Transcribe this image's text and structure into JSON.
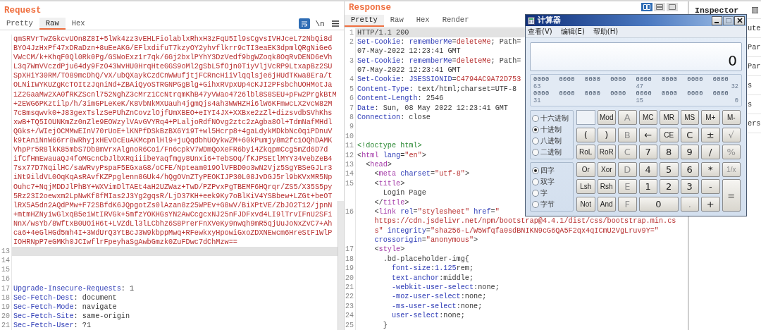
{
  "request": {
    "title": "Request",
    "tabs": [
      {
        "label": "Pretty",
        "selected": false
      },
      {
        "label": "Raw",
        "selected": true
      },
      {
        "label": "Hex",
        "selected": false
      }
    ],
    "tools": [
      {
        "kind": "wrap",
        "selected": true
      },
      {
        "kind": "newline",
        "label": "\\n",
        "selected": false
      },
      {
        "kind": "menu",
        "selected": false
      }
    ],
    "lines": [
      {
        "segments": [
          {
            "kind": "string",
            "text": "qmSRVrTwZGkcvUOn8Z8I+5lWk4zz3vEHLFiolablxRhxH3zFqU5Il9sCgvsIVHJceL72NbQi8d"
          }
        ],
        "highlighted": false
      },
      {
        "segments": [
          {
            "kind": "string",
            "text": "BYO4JzHxPf47xDRaDzn+8uEeAKG/EFlxdifuT7kzyOY2yhvflkrr9cTI3eaEK3dpmlQRgNiGe6"
          }
        ],
        "highlighted": false
      },
      {
        "segments": [
          {
            "kind": "string",
            "text": "VWcCM/k+KhqF0Ql0Rk0Pg/GSWoExz1r7qk/6Gj2bxlPYhY3DzVedf9bgWZoqk8OqRvDEND6eVh"
          }
        ],
        "highlighted": false
      },
      {
        "segments": [
          {
            "kind": "string",
            "text": "L3q7WmVVczdPju64dy9Fz043WvHU0HrqHteGGS9oMl2gSbL5fOjn0TiyVljVcRP9LtxapBz2SU"
          }
        ],
        "highlighted": false
      },
      {
        "segments": [
          {
            "kind": "string",
            "text": "SpXHiY30RM/TO89mcDhQ/vX/ubQXaykCzdCnWWufjtjFCRncHiiVlqqlsje6jHUdTKwa8Era/t"
          }
        ],
        "highlighted": false
      },
      {
        "segments": [
          {
            "kind": "string",
            "text": "OLNiIWYKUZgKcTOItzJqniNd+ZBAiQyoSTRGNPGgBlg+GihxRVpxUp4cKJI2PFsbchUOHMotJa"
          }
        ],
        "highlighted": false
      },
      {
        "segments": [
          {
            "kind": "string",
            "text": "1Z2GaaMw2XA0fRKZScnl752NghZ3cMrz1CcNtrqmKhB47yVWao4726lbl8S8SEU+pFw2PrgkBtM"
          }
        ],
        "highlighted": false
      },
      {
        "segments": [
          {
            "kind": "string",
            "text": "+2EWG6PKztilp/h/3imGPLeKeK/K8VbNkMXUauh4jgmQjs4ah3WWHZHi6lW6KFmwcLX2vcW82M"
          }
        ],
        "highlighted": false
      },
      {
        "segments": [
          {
            "kind": "string",
            "text": "7cBmsqwvk0+J83gexTslzSePUhZnCovzlOjfUmXBEO+eIYI4JX+XXBxe2zZl+dizsvdbSVhKhs"
          }
        ],
        "highlighted": false
      },
      {
        "segments": [
          {
            "kind": "string",
            "text": "xwB+TQ5IOUNKmZz0nZle9EOWzylVAvGVYRq4+PLaljoRdfNOvg2ztc2zAgba8Ol+TdmNafMHdl"
          }
        ],
        "highlighted": false
      },
      {
        "segments": [
          {
            "kind": "string",
            "text": "QGks+/WIejOCMMwEInV70rUoE+lKNPfDSkBzBX6Y19T+wl5Hcrp8+4gaLdykMDkbNc0qiPDnuV"
          }
        ],
        "highlighted": false
      },
      {
        "segments": [
          {
            "kind": "string",
            "text": "k9tAniNnW66rr8wRhyjxHEvOcEuAKMcpnlHl9+juQqdbhUOykwZM+60kPumjy8m2fc1OQhDAMK"
          }
        ],
        "highlighted": false
      },
      {
        "segments": [
          {
            "kind": "string",
            "text": "VhpPr5R8lkK85mbS7Db8mVrxAlgnoR6Coi/Fn6cpkV7WDmQoXeFR6byi4ZkqpmCcg5mZd6D7d"
          }
        ],
        "highlighted": false
      },
      {
        "segments": [
          {
            "kind": "string",
            "text": "ifCfHmEwauaQJ4foMGcnCbJlbXRqiiibeYaqfmgy8Unxi6+TebSOq/fKJPSEtlMYY34vebZeB4"
          }
        ],
        "highlighted": false
      },
      {
        "segments": [
          {
            "kind": "string",
            "text": "7sx77D7NqilHC/saWRvyPspaF5EGxaG8/oCFE/Npteam019OlVFBD0o3wN2Vjz5SgYBSeGJLr3"
          }
        ],
        "highlighted": false
      },
      {
        "segments": [
          {
            "kind": "string",
            "text": "iNt9ildVL0OqKqAsRAvfKZPpglenn8GUk4/hQgOVnZTyPEOKIJP30L08JvDGJ5rl9bKVxMR5Np"
          }
        ],
        "highlighted": false
      },
      {
        "segments": [
          {
            "kind": "string",
            "text": "Ouhc7+NqjMDDJlPhBY+WXVimDlTAEt4aH2UZWaz+TwD/PZPvxPgTBEMF6HQrqr/ZS5/X35S5py"
          }
        ],
        "highlighted": false
      },
      {
        "segments": [
          {
            "kind": "string",
            "text": "5Rz23I2oewxm2LpNwKf8fMIas2J3Yg2gqsR/LjD37KH+eek9Ky7oBlKiV4YSBbew+LZGt+beOT"
          }
        ],
        "highlighted": false
      },
      {
        "segments": [
          {
            "kind": "string",
            "text": "lRX5A5dn2AQdPMw+F72SBfdK6JQpgotZs0lAzan8z25WPEv+G8wV/BiXPtVE/ZbJO2T12/jpnN"
          }
        ],
        "highlighted": false
      },
      {
        "segments": [
          {
            "kind": "string",
            "text": "+mtmHZNyiwGlxqB5eiWtIRVGk+5mfzYOKHGsYN2AwCcgcxNJ25nFJDFxvd4LI9lTrvIFnU2SFi"
          }
        ],
        "highlighted": false
      },
      {
        "segments": [
          {
            "kind": "string",
            "text": "NnX/wsYb/8WftxB0UOiH6t+LVZdLl3lLCbhz6S8PrerFnXVeKy9nwqh9mR5qjUuJoNxZvC7+Ah"
          }
        ],
        "highlighted": false
      },
      {
        "segments": [
          {
            "kind": "string",
            "text": "ca6+4eGlHGd5mh4I+3WdUrQ3YtBcJ3W9kbppMwq+RFewkxyHpowiGxoZDXNEwcm6HreStF1WlP"
          }
        ],
        "highlighted": false
      },
      {
        "segments": [
          {
            "kind": "string",
            "text": "IOHRNpP7eGMKh0JCIwflrFpeyhaSgAwbGmzk0ZuFDwc7dChMzw=="
          }
        ],
        "highlighted": false
      },
      {
        "number": "13",
        "highlighted": true
      },
      {
        "number": "14",
        "highlighted": false
      },
      {
        "number": "15",
        "highlighted": false
      },
      {
        "number": "16",
        "highlighted": false
      },
      {
        "number": "17",
        "segments": [
          {
            "kind": "key",
            "text": "Upgrade-Insecure-Requests"
          },
          {
            "kind": "plain",
            "text": ": 1"
          }
        ],
        "highlighted": false
      },
      {
        "number": "18",
        "segments": [
          {
            "kind": "key",
            "text": "Sec-Fetch-Dest"
          },
          {
            "kind": "plain",
            "text": ": document"
          }
        ],
        "highlighted": false
      },
      {
        "number": "19",
        "segments": [
          {
            "kind": "key",
            "text": "Sec-Fetch-Mode"
          },
          {
            "kind": "plain",
            "text": ": navigate"
          }
        ],
        "highlighted": false
      },
      {
        "number": "20",
        "segments": [
          {
            "kind": "key",
            "text": "Sec-Fetch-Site"
          },
          {
            "kind": "plain",
            "text": ": same-origin"
          }
        ],
        "highlighted": false
      },
      {
        "number": "21",
        "segments": [
          {
            "kind": "key",
            "text": "Sec-Fetch-User"
          },
          {
            "kind": "plain",
            "text": ": ?1"
          }
        ],
        "highlighted": false
      }
    ]
  },
  "response": {
    "title": "Response",
    "tabs": [
      {
        "label": "Pretty",
        "selected": true
      },
      {
        "label": "Raw",
        "selected": false
      },
      {
        "label": "Hex",
        "selected": false
      },
      {
        "label": "Render",
        "selected": false
      }
    ],
    "lines": [
      {
        "number": "1",
        "segments": [
          {
            "kind": "plain",
            "text": "HTTP/1.1 200"
          }
        ],
        "highlighted": true
      },
      {
        "number": "2",
        "segments": [
          {
            "kind": "key",
            "text": "Set-Cookie"
          },
          {
            "kind": "plain",
            "text": ": "
          },
          {
            "kind": "key",
            "text": "rememberMe"
          },
          {
            "kind": "plain",
            "text": "="
          },
          {
            "kind": "string",
            "text": "deleteMe"
          },
          {
            "kind": "plain",
            "text": "; Path="
          }
        ],
        "highlighted": false
      },
      {
        "segments": [
          {
            "kind": "plain",
            "text": "07-May-2022 12:23:41 GMT"
          }
        ],
        "highlighted": false
      },
      {
        "number": "3",
        "segments": [
          {
            "kind": "key",
            "text": "Set-Cookie"
          },
          {
            "kind": "plain",
            "text": ": "
          },
          {
            "kind": "key",
            "text": "rememberMe"
          },
          {
            "kind": "plain",
            "text": "="
          },
          {
            "kind": "string",
            "text": "deleteMe"
          },
          {
            "kind": "plain",
            "text": "; Path="
          }
        ],
        "highlighted": false
      },
      {
        "segments": [
          {
            "kind": "plain",
            "text": "07-May-2022 12:23:41 GMT"
          }
        ],
        "highlighted": false
      },
      {
        "number": "4",
        "segments": [
          {
            "kind": "key",
            "text": "Set-Cookie"
          },
          {
            "kind": "plain",
            "text": ": "
          },
          {
            "kind": "key",
            "text": "JSESSIONID"
          },
          {
            "kind": "plain",
            "text": "="
          },
          {
            "kind": "string",
            "text": "C4794AC9A72D753"
          }
        ],
        "highlighted": false
      },
      {
        "number": "5",
        "segments": [
          {
            "kind": "key",
            "text": "Content-Type"
          },
          {
            "kind": "plain",
            "text": ": text/html;charset=UTF-8"
          }
        ],
        "highlighted": false
      },
      {
        "number": "6",
        "segments": [
          {
            "kind": "key",
            "text": "Content-Length"
          },
          {
            "kind": "plain",
            "text": ": 2546"
          }
        ],
        "highlighted": false
      },
      {
        "number": "7",
        "segments": [
          {
            "kind": "key",
            "text": "Date"
          },
          {
            "kind": "plain",
            "text": ": Sun, 08 May 2022 12:23:41 GMT"
          }
        ],
        "highlighted": false
      },
      {
        "number": "8",
        "segments": [
          {
            "kind": "key",
            "text": "Connection"
          },
          {
            "kind": "plain",
            "text": ": close"
          }
        ],
        "highlighted": false
      },
      {
        "number": "9",
        "highlighted": false
      },
      {
        "number": "10",
        "highlighted": false
      },
      {
        "number": "11",
        "segments": [
          {
            "kind": "doctype",
            "text": "<!doctype html>"
          }
        ],
        "highlighted": false
      },
      {
        "number": "12",
        "segments": [
          {
            "kind": "plain",
            "text": "<"
          },
          {
            "kind": "tag",
            "text": "html"
          },
          {
            "kind": "key",
            "text": " lang"
          },
          {
            "kind": "plain",
            "text": "="
          },
          {
            "kind": "string",
            "text": "\"en\""
          },
          {
            "kind": "plain",
            "text": ">"
          }
        ],
        "highlighted": false
      },
      {
        "number": "13",
        "segments": [
          {
            "kind": "plain",
            "text": "  <"
          },
          {
            "kind": "tag",
            "text": "head"
          },
          {
            "kind": "plain",
            "text": ">"
          }
        ],
        "highlighted": false
      },
      {
        "number": "14",
        "segments": [
          {
            "kind": "plain",
            "text": "    <"
          },
          {
            "kind": "tag",
            "text": "meta"
          },
          {
            "kind": "key",
            "text": " charset"
          },
          {
            "kind": "plain",
            "text": "="
          },
          {
            "kind": "string",
            "text": "\"utf-8\""
          },
          {
            "kind": "plain",
            "text": ">"
          }
        ],
        "highlighted": false
      },
      {
        "number": "15",
        "segments": [
          {
            "kind": "plain",
            "text": "    <"
          },
          {
            "kind": "tag",
            "text": "title"
          },
          {
            "kind": "plain",
            "text": ">"
          }
        ],
        "highlighted": false
      },
      {
        "segments": [
          {
            "kind": "plain",
            "text": "      Login Page"
          }
        ],
        "highlighted": false
      },
      {
        "segments": [
          {
            "kind": "plain",
            "text": "    </"
          },
          {
            "kind": "tag",
            "text": "title"
          },
          {
            "kind": "plain",
            "text": ">"
          }
        ],
        "highlighted": false
      },
      {
        "number": "16",
        "segments": [
          {
            "kind": "plain",
            "text": "    <"
          },
          {
            "kind": "tag",
            "text": "link"
          },
          {
            "kind": "key",
            "text": " rel"
          },
          {
            "kind": "plain",
            "text": "="
          },
          {
            "kind": "string",
            "text": "\"stylesheet\""
          },
          {
            "kind": "key",
            "text": " href"
          },
          {
            "kind": "plain",
            "text": "="
          },
          {
            "kind": "string",
            "text": "\""
          }
        ],
        "highlighted": false
      },
      {
        "segments": [
          {
            "kind": "string",
            "text": "    https://cdn.jsdelivr.net/npm/bootstrap@4.4.1/dist/css/bootstrap.min.cs"
          }
        ],
        "highlighted": false
      },
      {
        "segments": [
          {
            "kind": "string",
            "text": "    s\""
          },
          {
            "kind": "key",
            "text": " integrity"
          },
          {
            "kind": "plain",
            "text": "="
          },
          {
            "kind": "string",
            "text": "\"sha256-L/W5Wfqfa0sdBNIKN9cG6QA5F2qx4qICmU2VgLruv9Y=\""
          }
        ],
        "highlighted": false
      },
      {
        "segments": [
          {
            "kind": "key",
            "text": "    crossorigin"
          },
          {
            "kind": "plain",
            "text": "="
          },
          {
            "kind": "string",
            "text": "\"anonymous\""
          },
          {
            "kind": "plain",
            "text": ">"
          }
        ],
        "highlighted": false
      },
      {
        "number": "17",
        "segments": [
          {
            "kind": "plain",
            "text": "    <"
          },
          {
            "kind": "tag",
            "text": "style"
          },
          {
            "kind": "plain",
            "text": ">"
          }
        ],
        "highlighted": false
      },
      {
        "number": "18",
        "segments": [
          {
            "kind": "plain",
            "text": "      .bd-placeholder-img{"
          }
        ],
        "highlighted": false
      },
      {
        "number": "19",
        "segments": [
          {
            "kind": "key",
            "text": "        font-size"
          },
          {
            "kind": "plain",
            "text": ":"
          },
          {
            "kind": "key",
            "text": "1.125"
          },
          {
            "kind": "plain",
            "text": "rem;"
          }
        ],
        "highlighted": false
      },
      {
        "number": "20",
        "segments": [
          {
            "kind": "key",
            "text": "        text-anchor"
          },
          {
            "kind": "plain",
            "text": ":middle;"
          }
        ],
        "highlighted": false
      },
      {
        "number": "21",
        "segments": [
          {
            "kind": "key",
            "text": "        -webkit-user-select"
          },
          {
            "kind": "plain",
            "text": ":none;"
          }
        ],
        "highlighted": false
      },
      {
        "number": "22",
        "segments": [
          {
            "kind": "key",
            "text": "        -moz-user-select"
          },
          {
            "kind": "plain",
            "text": ":none;"
          }
        ],
        "highlighted": false
      },
      {
        "number": "23",
        "segments": [
          {
            "kind": "key",
            "text": "        -ms-user-select"
          },
          {
            "kind": "plain",
            "text": ":none;"
          }
        ],
        "highlighted": false
      },
      {
        "number": "24",
        "segments": [
          {
            "kind": "key",
            "text": "        user-select"
          },
          {
            "kind": "plain",
            "text": ":none;"
          }
        ],
        "highlighted": false
      },
      {
        "number": "25",
        "segments": [
          {
            "kind": "plain",
            "text": "      }"
          }
        ],
        "highlighted": false
      }
    ]
  },
  "view_toggle": [
    {
      "kind": "columns",
      "selected": true
    },
    {
      "kind": "rows",
      "selected": false
    },
    {
      "kind": "tabs",
      "selected": false
    }
  ],
  "inspector": {
    "title": "Inspector",
    "rows": [
      "ute",
      "Par",
      "Par",
      "s",
      "s",
      "ers"
    ]
  },
  "calculator": {
    "title": "计算器",
    "menu": [
      "查看(V)",
      "编辑(E)",
      "帮助(H)"
    ],
    "display": "0",
    "bits": [
      {
        "groups": [
          {
            "bits": "0000",
            "label": "63"
          },
          {
            "bits": "0000"
          },
          {
            "bits": "0000"
          },
          {
            "bits": "0000"
          },
          {
            "bits": "0000",
            "label": "47"
          },
          {
            "bits": "0000"
          },
          {
            "bits": "0000"
          },
          {
            "bits": "0000",
            "label": "32"
          }
        ]
      },
      {
        "groups": [
          {
            "bits": "0000",
            "label": "31"
          },
          {
            "bits": "0000"
          },
          {
            "bits": "0000"
          },
          {
            "bits": "0000"
          },
          {
            "bits": "0000",
            "label": "15"
          },
          {
            "bits": "0000"
          },
          {
            "bits": "0000"
          },
          {
            "bits": "0000",
            "label": "0"
          }
        ]
      }
    ],
    "bases": [
      {
        "label": "十六进制",
        "selected": false
      },
      {
        "label": "十进制",
        "selected": true
      },
      {
        "label": "八进制",
        "selected": false
      },
      {
        "label": "二进制",
        "selected": false
      }
    ],
    "sizes": [
      {
        "label": "四字",
        "selected": true
      },
      {
        "label": "双字",
        "selected": false
      },
      {
        "label": "字",
        "selected": false
      },
      {
        "label": "字节",
        "selected": false
      }
    ],
    "keys": [
      {
        "kind": "box"
      },
      {
        "kind": "key",
        "label": "Mod",
        "disabled": false
      },
      {
        "kind": "key",
        "label": "A",
        "disabled": true
      },
      {
        "kind": "key",
        "label": "MC",
        "disabled": false
      },
      {
        "kind": "key",
        "label": "MR",
        "disabled": false
      },
      {
        "kind": "key",
        "label": "MS",
        "disabled": false
      },
      {
        "kind": "key",
        "label": "M+",
        "disabled": false
      },
      {
        "kind": "key",
        "label": "M-",
        "disabled": false
      },
      {
        "kind": "key",
        "label": "(",
        "disabled": false
      },
      {
        "kind": "key",
        "label": ")",
        "disabled": false
      },
      {
        "kind": "key",
        "label": "B",
        "disabled": true
      },
      {
        "kind": "key",
        "label": "←",
        "disabled": false
      },
      {
        "kind": "key",
        "label": "CE",
        "disabled": false
      },
      {
        "kind": "key",
        "label": "C",
        "disabled": false
      },
      {
        "kind": "key",
        "label": "±",
        "disabled": false
      },
      {
        "kind": "key",
        "label": "√",
        "disabled": true
      },
      {
        "kind": "key",
        "label": "RoL",
        "disabled": false
      },
      {
        "kind": "key",
        "label": "RoR",
        "disabled": false
      },
      {
        "kind": "key",
        "label": "C",
        "disabled": true
      },
      {
        "kind": "key",
        "label": "7",
        "disabled": false
      },
      {
        "kind": "key",
        "label": "8",
        "disabled": false
      },
      {
        "kind": "key",
        "label": "9",
        "disabled": false
      },
      {
        "kind": "key",
        "label": "/",
        "disabled": false
      },
      {
        "kind": "key",
        "label": "%",
        "disabled": true
      },
      {
        "kind": "key",
        "label": "Or",
        "disabled": false
      },
      {
        "kind": "key",
        "label": "Xor",
        "disabled": false
      },
      {
        "kind": "key",
        "label": "D",
        "disabled": true
      },
      {
        "kind": "key",
        "label": "4",
        "disabled": false
      },
      {
        "kind": "key",
        "label": "5",
        "disabled": false
      },
      {
        "kind": "key",
        "label": "6",
        "disabled": false
      },
      {
        "kind": "key",
        "label": "*",
        "disabled": false
      },
      {
        "kind": "key",
        "label": "1/x",
        "disabled": true
      },
      {
        "kind": "key",
        "label": "Lsh",
        "disabled": false
      },
      {
        "kind": "key",
        "label": "Rsh",
        "disabled": false
      },
      {
        "kind": "key",
        "label": "E",
        "disabled": true
      },
      {
        "kind": "key",
        "label": "1",
        "disabled": false
      },
      {
        "kind": "key",
        "label": "2",
        "disabled": false
      },
      {
        "kind": "key",
        "label": "3",
        "disabled": false
      },
      {
        "kind": "key",
        "label": "-",
        "disabled": false
      },
      {
        "kind": "tall",
        "label": "=",
        "disabled": false
      },
      {
        "kind": "key",
        "label": "Not",
        "disabled": false
      },
      {
        "kind": "key",
        "label": "And",
        "disabled": false
      },
      {
        "kind": "key",
        "label": "F",
        "disabled": true
      },
      {
        "kind": "wide",
        "label": "0",
        "disabled": false
      },
      {
        "kind": "key",
        "label": ".",
        "disabled": true
      },
      {
        "kind": "key",
        "label": "+",
        "disabled": false
      }
    ]
  }
}
